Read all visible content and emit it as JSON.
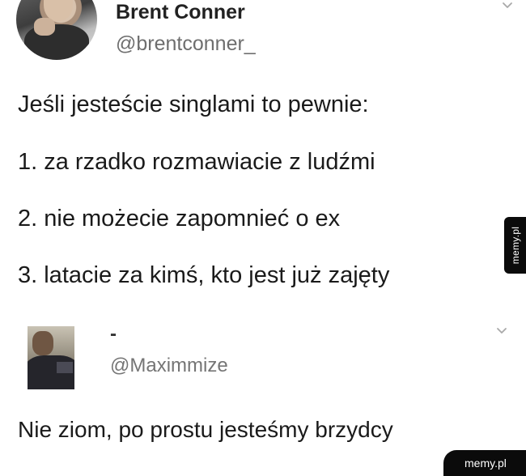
{
  "tweet": {
    "author": {
      "display_name": "Brent Conner",
      "handle": "@brentconner_"
    },
    "menu_icon": "chevron-down-icon",
    "lines": [
      "Jeśli jesteście singlami to pewnie:",
      "1. za rzadko rozmawiacie z ludźmi",
      "2. nie możecie zapomnieć o ex",
      "3. latacie za kimś, kto jest już zajęty"
    ]
  },
  "reply": {
    "author": {
      "display_name": "-",
      "handle": "@Maximmize"
    },
    "menu_icon": "chevron-down-icon",
    "text": "Nie ziom, po prostu jesteśmy brzydcy"
  },
  "watermarks": {
    "side": "memy.pl",
    "corner": "memy.pl"
  },
  "colors": {
    "background": "#ffffff",
    "text": "#1a1a1a",
    "secondary_text": "#6e6e6e",
    "watermark_bg": "#0b0b0b"
  }
}
